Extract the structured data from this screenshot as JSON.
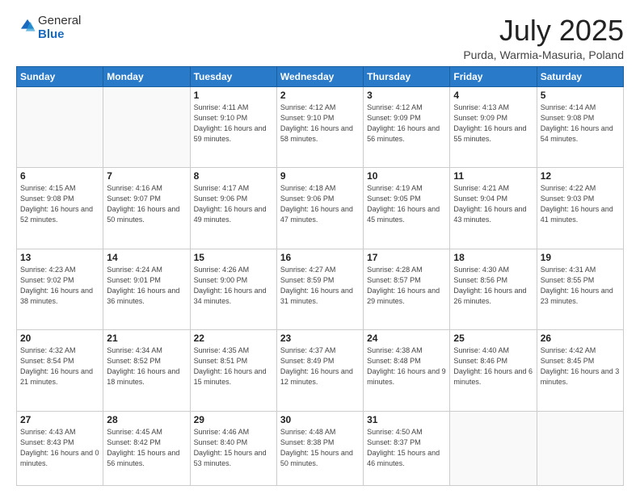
{
  "header": {
    "logo_general": "General",
    "logo_blue": "Blue",
    "title": "July 2025",
    "subtitle": "Purda, Warmia-Masuria, Poland"
  },
  "days_of_week": [
    "Sunday",
    "Monday",
    "Tuesday",
    "Wednesday",
    "Thursday",
    "Friday",
    "Saturday"
  ],
  "weeks": [
    [
      {
        "day": "",
        "info": ""
      },
      {
        "day": "",
        "info": ""
      },
      {
        "day": "1",
        "info": "Sunrise: 4:11 AM\nSunset: 9:10 PM\nDaylight: 16 hours and 59 minutes."
      },
      {
        "day": "2",
        "info": "Sunrise: 4:12 AM\nSunset: 9:10 PM\nDaylight: 16 hours and 58 minutes."
      },
      {
        "day": "3",
        "info": "Sunrise: 4:12 AM\nSunset: 9:09 PM\nDaylight: 16 hours and 56 minutes."
      },
      {
        "day": "4",
        "info": "Sunrise: 4:13 AM\nSunset: 9:09 PM\nDaylight: 16 hours and 55 minutes."
      },
      {
        "day": "5",
        "info": "Sunrise: 4:14 AM\nSunset: 9:08 PM\nDaylight: 16 hours and 54 minutes."
      }
    ],
    [
      {
        "day": "6",
        "info": "Sunrise: 4:15 AM\nSunset: 9:08 PM\nDaylight: 16 hours and 52 minutes."
      },
      {
        "day": "7",
        "info": "Sunrise: 4:16 AM\nSunset: 9:07 PM\nDaylight: 16 hours and 50 minutes."
      },
      {
        "day": "8",
        "info": "Sunrise: 4:17 AM\nSunset: 9:06 PM\nDaylight: 16 hours and 49 minutes."
      },
      {
        "day": "9",
        "info": "Sunrise: 4:18 AM\nSunset: 9:06 PM\nDaylight: 16 hours and 47 minutes."
      },
      {
        "day": "10",
        "info": "Sunrise: 4:19 AM\nSunset: 9:05 PM\nDaylight: 16 hours and 45 minutes."
      },
      {
        "day": "11",
        "info": "Sunrise: 4:21 AM\nSunset: 9:04 PM\nDaylight: 16 hours and 43 minutes."
      },
      {
        "day": "12",
        "info": "Sunrise: 4:22 AM\nSunset: 9:03 PM\nDaylight: 16 hours and 41 minutes."
      }
    ],
    [
      {
        "day": "13",
        "info": "Sunrise: 4:23 AM\nSunset: 9:02 PM\nDaylight: 16 hours and 38 minutes."
      },
      {
        "day": "14",
        "info": "Sunrise: 4:24 AM\nSunset: 9:01 PM\nDaylight: 16 hours and 36 minutes."
      },
      {
        "day": "15",
        "info": "Sunrise: 4:26 AM\nSunset: 9:00 PM\nDaylight: 16 hours and 34 minutes."
      },
      {
        "day": "16",
        "info": "Sunrise: 4:27 AM\nSunset: 8:59 PM\nDaylight: 16 hours and 31 minutes."
      },
      {
        "day": "17",
        "info": "Sunrise: 4:28 AM\nSunset: 8:57 PM\nDaylight: 16 hours and 29 minutes."
      },
      {
        "day": "18",
        "info": "Sunrise: 4:30 AM\nSunset: 8:56 PM\nDaylight: 16 hours and 26 minutes."
      },
      {
        "day": "19",
        "info": "Sunrise: 4:31 AM\nSunset: 8:55 PM\nDaylight: 16 hours and 23 minutes."
      }
    ],
    [
      {
        "day": "20",
        "info": "Sunrise: 4:32 AM\nSunset: 8:54 PM\nDaylight: 16 hours and 21 minutes."
      },
      {
        "day": "21",
        "info": "Sunrise: 4:34 AM\nSunset: 8:52 PM\nDaylight: 16 hours and 18 minutes."
      },
      {
        "day": "22",
        "info": "Sunrise: 4:35 AM\nSunset: 8:51 PM\nDaylight: 16 hours and 15 minutes."
      },
      {
        "day": "23",
        "info": "Sunrise: 4:37 AM\nSunset: 8:49 PM\nDaylight: 16 hours and 12 minutes."
      },
      {
        "day": "24",
        "info": "Sunrise: 4:38 AM\nSunset: 8:48 PM\nDaylight: 16 hours and 9 minutes."
      },
      {
        "day": "25",
        "info": "Sunrise: 4:40 AM\nSunset: 8:46 PM\nDaylight: 16 hours and 6 minutes."
      },
      {
        "day": "26",
        "info": "Sunrise: 4:42 AM\nSunset: 8:45 PM\nDaylight: 16 hours and 3 minutes."
      }
    ],
    [
      {
        "day": "27",
        "info": "Sunrise: 4:43 AM\nSunset: 8:43 PM\nDaylight: 16 hours and 0 minutes."
      },
      {
        "day": "28",
        "info": "Sunrise: 4:45 AM\nSunset: 8:42 PM\nDaylight: 15 hours and 56 minutes."
      },
      {
        "day": "29",
        "info": "Sunrise: 4:46 AM\nSunset: 8:40 PM\nDaylight: 15 hours and 53 minutes."
      },
      {
        "day": "30",
        "info": "Sunrise: 4:48 AM\nSunset: 8:38 PM\nDaylight: 15 hours and 50 minutes."
      },
      {
        "day": "31",
        "info": "Sunrise: 4:50 AM\nSunset: 8:37 PM\nDaylight: 15 hours and 46 minutes."
      },
      {
        "day": "",
        "info": ""
      },
      {
        "day": "",
        "info": ""
      }
    ]
  ]
}
